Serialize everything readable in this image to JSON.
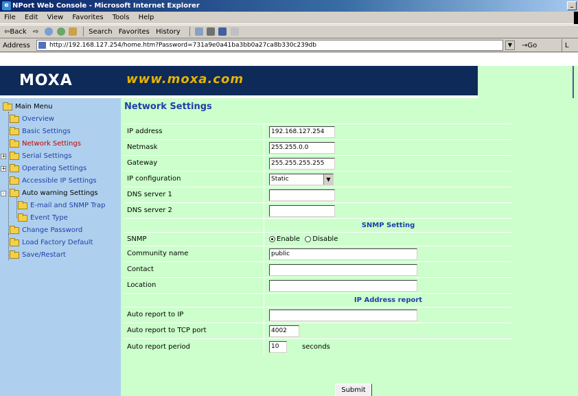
{
  "window": {
    "title": "NPort Web Console - Microsoft Internet Explorer",
    "icon": "ie-icon",
    "minimize": "_"
  },
  "menu": [
    "File",
    "Edit",
    "View",
    "Favorites",
    "Tools",
    "Help"
  ],
  "toolbar": {
    "back": "⇦Back",
    "forward": "⇨",
    "search": "Search",
    "favorites": "Favorites",
    "history": "History"
  },
  "address": {
    "label": "Address",
    "url": "http://192.168.127.254/home.htm?Password=731a9e0a41ba3bb0a27ca8b330c239db",
    "go": "→Go",
    "links": "L"
  },
  "banner": {
    "logo": "MOXA",
    "site": "www.moxa.com"
  },
  "sidebar": {
    "items": [
      {
        "label": "Main Menu",
        "level": 0,
        "state": "root"
      },
      {
        "label": "Overview",
        "level": 1
      },
      {
        "label": "Basic Settings",
        "level": 1
      },
      {
        "label": "Network Settings",
        "level": 1,
        "state": "selected"
      },
      {
        "label": "Serial Settings",
        "level": 1,
        "expand": "+"
      },
      {
        "label": "Operating Settings",
        "level": 1,
        "expand": "+"
      },
      {
        "label": "Accessible IP Settings",
        "level": 1
      },
      {
        "label": "Auto warning Settings",
        "level": 1,
        "expand": "-"
      },
      {
        "label": "E-mail and SNMP Trap",
        "level": 2
      },
      {
        "label": "Event Type",
        "level": 2
      },
      {
        "label": "Change Password",
        "level": 1
      },
      {
        "label": "Load Factory Default",
        "level": 1
      },
      {
        "label": "Save/Restart",
        "level": 1
      }
    ]
  },
  "main": {
    "title": "Network Settings",
    "fields": {
      "ip_address": {
        "label": "IP address",
        "value": "192.168.127.254"
      },
      "netmask": {
        "label": "Netmask",
        "value": "255.255.0.0"
      },
      "gateway": {
        "label": "Gateway",
        "value": "255.255.255.255"
      },
      "ip_config": {
        "label": "IP configuration",
        "value": "Static"
      },
      "dns1": {
        "label": "DNS server 1",
        "value": ""
      },
      "dns2": {
        "label": "DNS server 2",
        "value": ""
      }
    },
    "snmp_section": "SNMP Setting",
    "snmp": {
      "label": "SNMP",
      "enable": "Enable",
      "disable": "Disable",
      "selected": "Enable"
    },
    "community": {
      "label": "Community name",
      "value": "public"
    },
    "contact": {
      "label": "Contact",
      "value": ""
    },
    "location": {
      "label": "Location",
      "value": ""
    },
    "report_section": "IP Address report",
    "auto_ip": {
      "label": "Auto report to IP",
      "value": ""
    },
    "auto_port": {
      "label": "Auto report to TCP port",
      "value": "4002"
    },
    "auto_period": {
      "label": "Auto report period",
      "value": "10",
      "unit": "seconds"
    },
    "submit": "Submit"
  },
  "colors": {
    "sidebar_bg": "#aed0ee",
    "main_bg": "#ccffcc",
    "banner_bg": "#0e2a58",
    "link": "#1f3ea8",
    "selected": "#c00000"
  }
}
